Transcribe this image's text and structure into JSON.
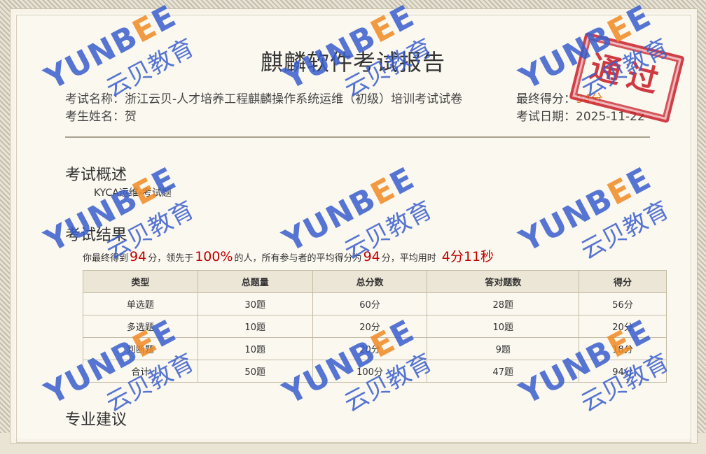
{
  "report": {
    "title": "麒麟软件考试报告",
    "exam_name_label": "考试名称：",
    "exam_name": "浙江云贝-人才培养工程麒麟操作系统运维（初级）培训考试试卷",
    "student_label": "考生姓名：",
    "student_name": "贺",
    "final_score_label": "最终得分：",
    "final_score": "94分",
    "date_label": "考试日期：",
    "date": "2025-11-22",
    "stamp_text": "通过",
    "colors": {
      "score": "#e07a1a",
      "highlight": "#c00000",
      "stamp": "#c81e28",
      "watermark_blue": "#3a5fcd",
      "watermark_orange": "#f08a24"
    }
  },
  "overview": {
    "heading": "考试概述",
    "text": "KYCA运维-考试题"
  },
  "results": {
    "heading": "考试结果",
    "line": {
      "p1": "你最终得到",
      "score": "94",
      "p2": "分，领先于",
      "percent": "100%",
      "p3": "的人，所有参与者的平均得分为",
      "avg": "94",
      "p4": "分，平均用时",
      "time": "4分11秒"
    },
    "columns": [
      "类型",
      "总题量",
      "总分数",
      "答对题数",
      "得分"
    ],
    "rows": [
      [
        "单选题",
        "30题",
        "60分",
        "28题",
        "56分"
      ],
      [
        "多选题",
        "10题",
        "20分",
        "10题",
        "20分"
      ],
      [
        "判断题",
        "10题",
        "20分",
        "9题",
        "18分"
      ],
      [
        "合计",
        "50题",
        "100分",
        "47题",
        "94分"
      ]
    ]
  },
  "advice": {
    "heading": "专业建议"
  },
  "watermark": {
    "brand_part1": "YUNB",
    "brand_e1": "E",
    "brand_e2": "E",
    "brand_cn": "云贝教育"
  }
}
